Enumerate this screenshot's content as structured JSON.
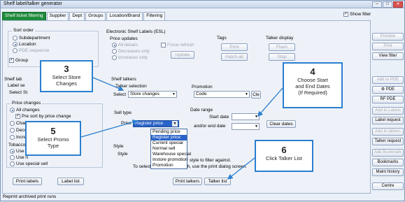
{
  "window": {
    "title": "Shelf label/talker generator",
    "minimize": "–",
    "maximize": "□",
    "close": "✕"
  },
  "tabs": [
    {
      "label": "Shelf ticket filtering"
    },
    {
      "label": "Supplier"
    },
    {
      "label": "Dept"
    },
    {
      "label": "Groups"
    },
    {
      "label": "Location/Brand"
    },
    {
      "label": "Filtering"
    }
  ],
  "show_filter": {
    "label": "Show filter",
    "checked": "✓"
  },
  "sort_order": {
    "title": "Sort order",
    "options": [
      "Subdepartment",
      "Location",
      "PDE sequence"
    ],
    "group_label": "Group"
  },
  "esl": {
    "title": "Electronic Shelf Labels (ESL)",
    "price_updates": "Price updates",
    "options": [
      "All details",
      "Decreases only",
      "Increases only"
    ],
    "force_refresh": "Force refresh",
    "update": "Update",
    "tags_title": "Tags",
    "print": "Print",
    "hatch_all": "Hatch-all",
    "talker_display_title": "Talker display",
    "flash": "Flash",
    "stop": "Stop"
  },
  "shelf_labels": {
    "title": "Shelf lab",
    "label_sel": "Label se",
    "select": "Select",
    "select_value": "St",
    "price_changes": "Price changes",
    "all_changes": "All changes",
    "pre_sort": "Pre sort by price change",
    "chan": "Chan",
    "deco": "Deco",
    "incre": "Incre",
    "tobacco": "Tobacco",
    "use_n1": "Use n",
    "use_n2": "Use n",
    "use_special": "Use special sell",
    "print_labels": "Print labels",
    "label_list": "Label list"
  },
  "shelf_talkers": {
    "title": "Shelf talkers",
    "talker_selection": "Talker selection",
    "select_label": "Select",
    "select_value": "Store changes",
    "promotion_title": "Promotion",
    "promotion_value": "Code",
    "clear_partial": "Cle",
    "sell_type_title": "Sell type",
    "price_label": "Price",
    "price_value": "Register price",
    "date_range_title": "Date range",
    "start_date": "Start date",
    "end_date": "and/or end date",
    "clear_dates": "Clear dates",
    "style_title": "Style",
    "style_label": "Style",
    "hint1": "style to filter against.",
    "hint2": "To select a style to print with, use the print dialog screen.",
    "print_talkers": "Print talkers",
    "talker_list": "Talker list"
  },
  "price_dropdown_options": [
    "Pending price",
    "Register price",
    "Current special",
    "Normal sell",
    "Warehouse special",
    "Instore promotion",
    "Promotion"
  ],
  "side_buttons": [
    "Preview",
    "Print",
    "View filter",
    "Add to PDE",
    "PDE",
    "RF PDE",
    "Add to Labels",
    "Label request",
    "Add to talkers",
    "Talker request",
    "Add Bookmark",
    "Bookmarks",
    "Maint history",
    "Centre"
  ],
  "reprint_label": "Reprint archived print runs",
  "callouts": [
    {
      "num": "3",
      "text": [
        "Select Store",
        "Changes"
      ]
    },
    {
      "num": "4",
      "text": [
        "Choose Start",
        "and End Dates",
        "(If Required)"
      ]
    },
    {
      "num": "5",
      "text": [
        "Select Promo",
        "Type"
      ]
    },
    {
      "num": "6",
      "text": [
        "Click Talker List"
      ]
    }
  ],
  "colors": {
    "active_tab": "#1f8a3b",
    "callout_border": "#2a7fd0",
    "selection": "#2a63c8"
  }
}
